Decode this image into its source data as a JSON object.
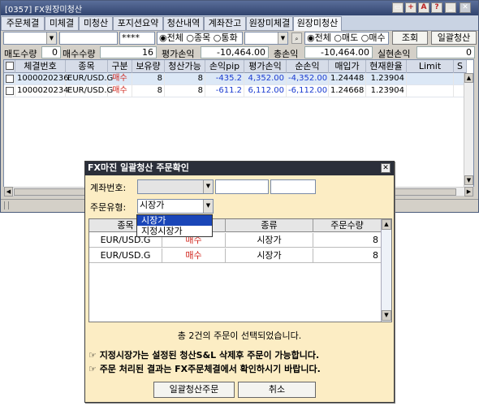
{
  "window": {
    "title": "[0357] FX원장미청산",
    "tabs": [
      "주문체결",
      "미체결",
      "미청산",
      "포지션요약",
      "청산내역",
      "계좌잔고",
      "원장미체결",
      "원장미청산"
    ],
    "active_tab": "원장미청산"
  },
  "filter": {
    "password": "****",
    "scope_options": [
      "전체",
      "종목",
      "통화"
    ],
    "scope_selected": "전체",
    "side_options": [
      "전체",
      "매도",
      "매수"
    ],
    "side_selected": "전체",
    "query_button": "조회",
    "bulk_close_button": "일괄청산"
  },
  "summary": {
    "sell_qty_label": "매도수량",
    "sell_qty": "0",
    "buy_qty_label": "매수수량",
    "buy_qty": "16",
    "eval_pl_label": "평가손익",
    "eval_pl": "-10,464.00",
    "total_pl_label": "총손익",
    "total_pl": "-10,464.00",
    "realized_pl_label": "실현손익",
    "realized_pl": "0"
  },
  "table": {
    "headers": [
      "체결번호",
      "종목",
      "구분",
      "보유량",
      "청산가능",
      "손익pip",
      "평가손익",
      "순손익",
      "매입가",
      "현재환율",
      "Limit",
      "S"
    ],
    "rows": [
      {
        "no": "1000020236",
        "symbol": "EUR/USD.G",
        "side": "매수",
        "hold": "8",
        "closable": "8",
        "pip": "-435.2",
        "eval": "4,352.00",
        "net": "-4,352.00",
        "buy": "1.24448",
        "cur": "1.23904"
      },
      {
        "no": "1000020234",
        "symbol": "EUR/USD.G",
        "side": "매수",
        "hold": "8",
        "closable": "8",
        "pip": "-611.2",
        "eval": "6,112.00",
        "net": "-6,112.00",
        "buy": "1.24668",
        "cur": "1.23904"
      }
    ]
  },
  "dialog": {
    "title": "FX마진 일괄청산 주문확인",
    "account_label": "계좌번호:",
    "order_type_label": "주문유형:",
    "order_type_value": "시장가",
    "order_type_options": [
      "시장가",
      "지정시장가"
    ],
    "headers": [
      "종목",
      "",
      "종류",
      "주문수량"
    ],
    "rows": [
      {
        "symbol": "EUR/USD.G",
        "side": "매수",
        "kind": "시장가",
        "qty": "8"
      },
      {
        "symbol": "EUR/USD.G",
        "side": "매수",
        "kind": "시장가",
        "qty": "8"
      }
    ],
    "selected_note": "총 2건의 주문이 선택되었습니다.",
    "warning1": "☞ 지정시장가는 설정된 청산S&L 삭제후 주문이 가능합니다.",
    "warning2": "☞ 주문 처리된 결과는 FX주문체결에서 확인하시기 바랍니다.",
    "confirm_button": "일괄청산주문",
    "cancel_button": "취소"
  }
}
